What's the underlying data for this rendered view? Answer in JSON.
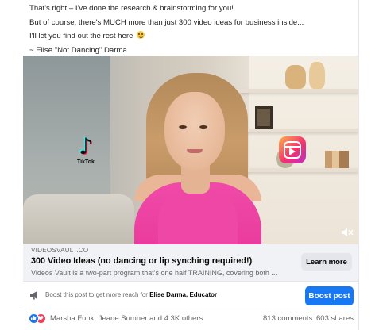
{
  "post": {
    "lines": [
      "That's right – I've done the research & brainstorming for you!",
      "But of course, there's MUCH more than just 300 video ideas for business inside...",
      "I'll let you find out the rest here",
      "~ Elise \"Not Dancing\" Darma"
    ],
    "emoji": "grinning-face-emoji"
  },
  "video": {
    "tiktok_label": "TikTok",
    "icons": [
      "tiktok-logo",
      "instagram-reels-icon",
      "muted-speaker-icon"
    ]
  },
  "link_preview": {
    "domain": "VIDEOSVAULT.CO",
    "title": "300 Video Ideas (no dancing or lip synching required!)",
    "description": "Videos Vault is a two-part program that's one half TRAINING, covering both ...",
    "cta_label": "Learn more"
  },
  "boost": {
    "prefix": "Boost this post to get more reach for ",
    "page_name": "Elise Darma, Educator",
    "button_label": "Boost post",
    "icon": "megaphone-icon"
  },
  "engagement": {
    "reaction_icons": [
      "like",
      "love"
    ],
    "names": "Marsha Funk, Jeane Sumner and 4.3K others",
    "comments": "813 comments",
    "shares": "603 shares"
  },
  "colors": {
    "primary_blue": "#1877f2",
    "love_red": "#f33e58",
    "secondary_text": "#65676b",
    "link_bg": "#f0f2f5"
  }
}
